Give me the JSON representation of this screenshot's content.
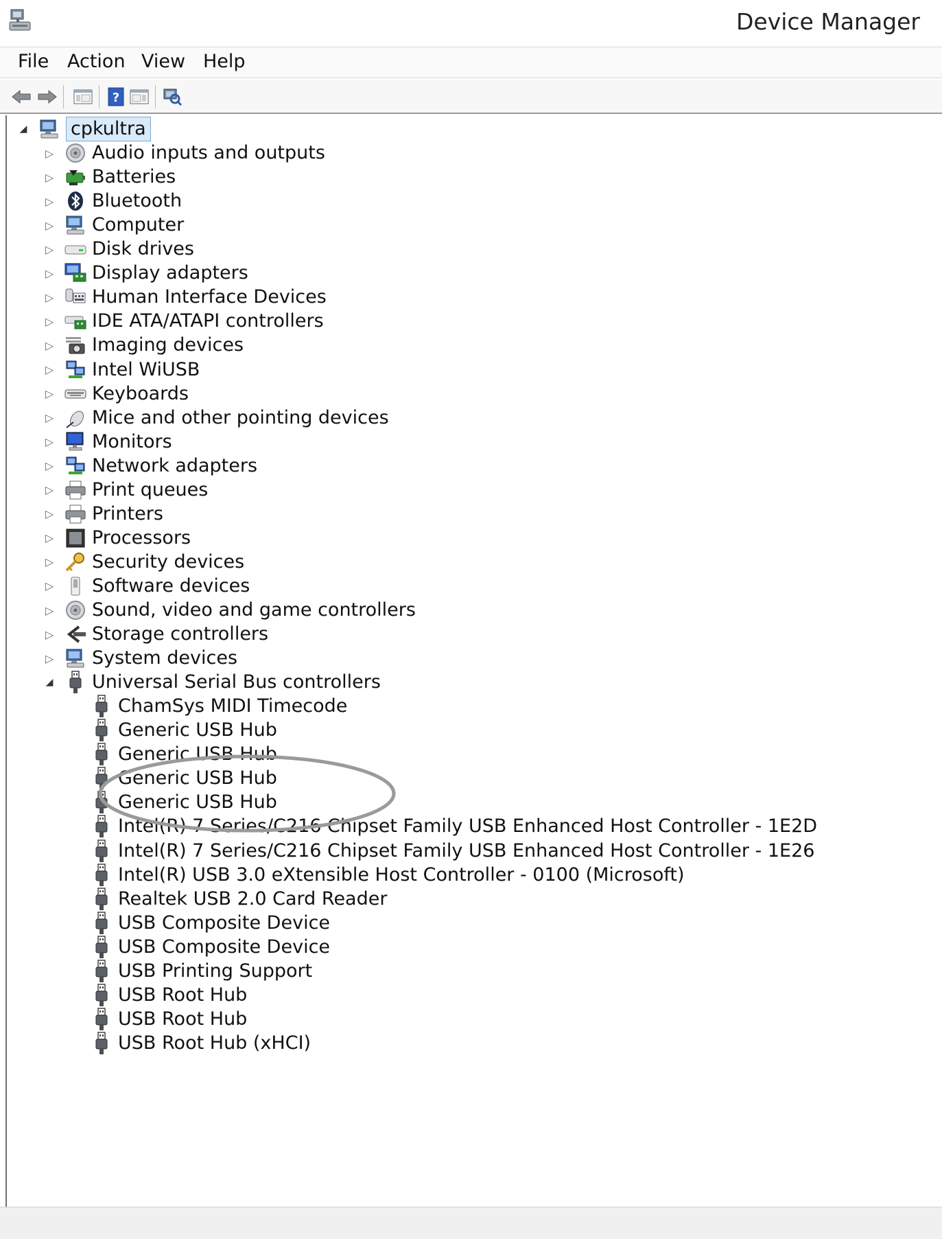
{
  "window": {
    "title": "Device Manager",
    "app_icon": "device-manager-icon"
  },
  "menu": {
    "file": "File",
    "action": "Action",
    "view": "View",
    "help": "Help"
  },
  "toolbar": {
    "buttons": [
      "back-arrow-icon",
      "forward-arrow-icon",
      "show-hide-console-tree-icon",
      "help-icon",
      "properties-icon",
      "scan-hardware-icon"
    ]
  },
  "tree": {
    "root": {
      "label": "cpkultra",
      "icon": "computer-icon"
    },
    "categories": [
      {
        "label": "Audio inputs and outputs",
        "icon": "speaker-icon"
      },
      {
        "label": "Batteries",
        "icon": "battery-icon"
      },
      {
        "label": "Bluetooth",
        "icon": "bluetooth-icon"
      },
      {
        "label": "Computer",
        "icon": "computer-icon"
      },
      {
        "label": "Disk drives",
        "icon": "disk-drive-icon"
      },
      {
        "label": "Display adapters",
        "icon": "display-adapter-icon"
      },
      {
        "label": "Human Interface Devices",
        "icon": "hid-icon"
      },
      {
        "label": "IDE ATA/ATAPI controllers",
        "icon": "ide-controller-icon"
      },
      {
        "label": "Imaging devices",
        "icon": "camera-icon"
      },
      {
        "label": "Intel WiUSB",
        "icon": "network-icon"
      },
      {
        "label": "Keyboards",
        "icon": "keyboard-icon"
      },
      {
        "label": "Mice and other pointing devices",
        "icon": "mouse-icon"
      },
      {
        "label": "Monitors",
        "icon": "monitor-icon"
      },
      {
        "label": "Network adapters",
        "icon": "network-icon"
      },
      {
        "label": "Print queues",
        "icon": "printer-icon"
      },
      {
        "label": "Printers",
        "icon": "printer-icon"
      },
      {
        "label": "Processors",
        "icon": "processor-icon"
      },
      {
        "label": "Security devices",
        "icon": "key-icon"
      },
      {
        "label": "Software devices",
        "icon": "software-device-icon"
      },
      {
        "label": "Sound, video and game controllers",
        "icon": "speaker-icon"
      },
      {
        "label": "Storage controllers",
        "icon": "storage-controller-icon"
      },
      {
        "label": "System devices",
        "icon": "computer-icon"
      },
      {
        "label": "Universal Serial Bus controllers",
        "icon": "usb-plug-icon",
        "expanded": true
      }
    ],
    "usb_children": [
      "ChamSys MIDI Timecode",
      "Generic USB Hub",
      "Generic USB Hub",
      "Generic USB Hub",
      "Generic USB Hub",
      "Intel(R) 7 Series/C216 Chipset Family USB Enhanced Host Controller - 1E2D",
      "Intel(R) 7 Series/C216 Chipset Family USB Enhanced Host Controller - 1E26",
      "Intel(R) USB 3.0 eXtensible Host Controller - 0100 (Microsoft)",
      "Realtek USB 2.0 Card Reader",
      "USB Composite Device",
      "USB Composite Device",
      "USB Printing Support",
      "USB Root Hub",
      "USB Root Hub",
      "USB Root Hub (xHCI)"
    ]
  },
  "colors": {
    "selection": "#d9eaf9",
    "selection_border": "#7aa9d6",
    "annotation": "#9a9a9a"
  }
}
